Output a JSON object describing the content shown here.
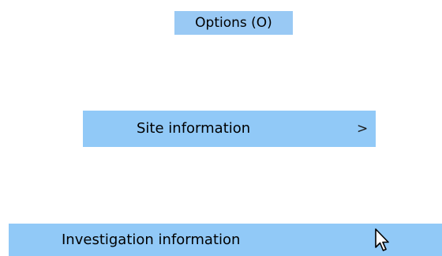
{
  "menu": {
    "title": "Options (O)",
    "items": [
      {
        "label": "Site information",
        "submenu_glyph": ">"
      },
      {
        "label": "Investigation information"
      }
    ]
  },
  "colors": {
    "highlight": "#91c9f7",
    "title_highlight": "#99c9f4",
    "background": "#ffffff"
  },
  "cursor": {
    "icon": "arrow-pointer-icon"
  }
}
